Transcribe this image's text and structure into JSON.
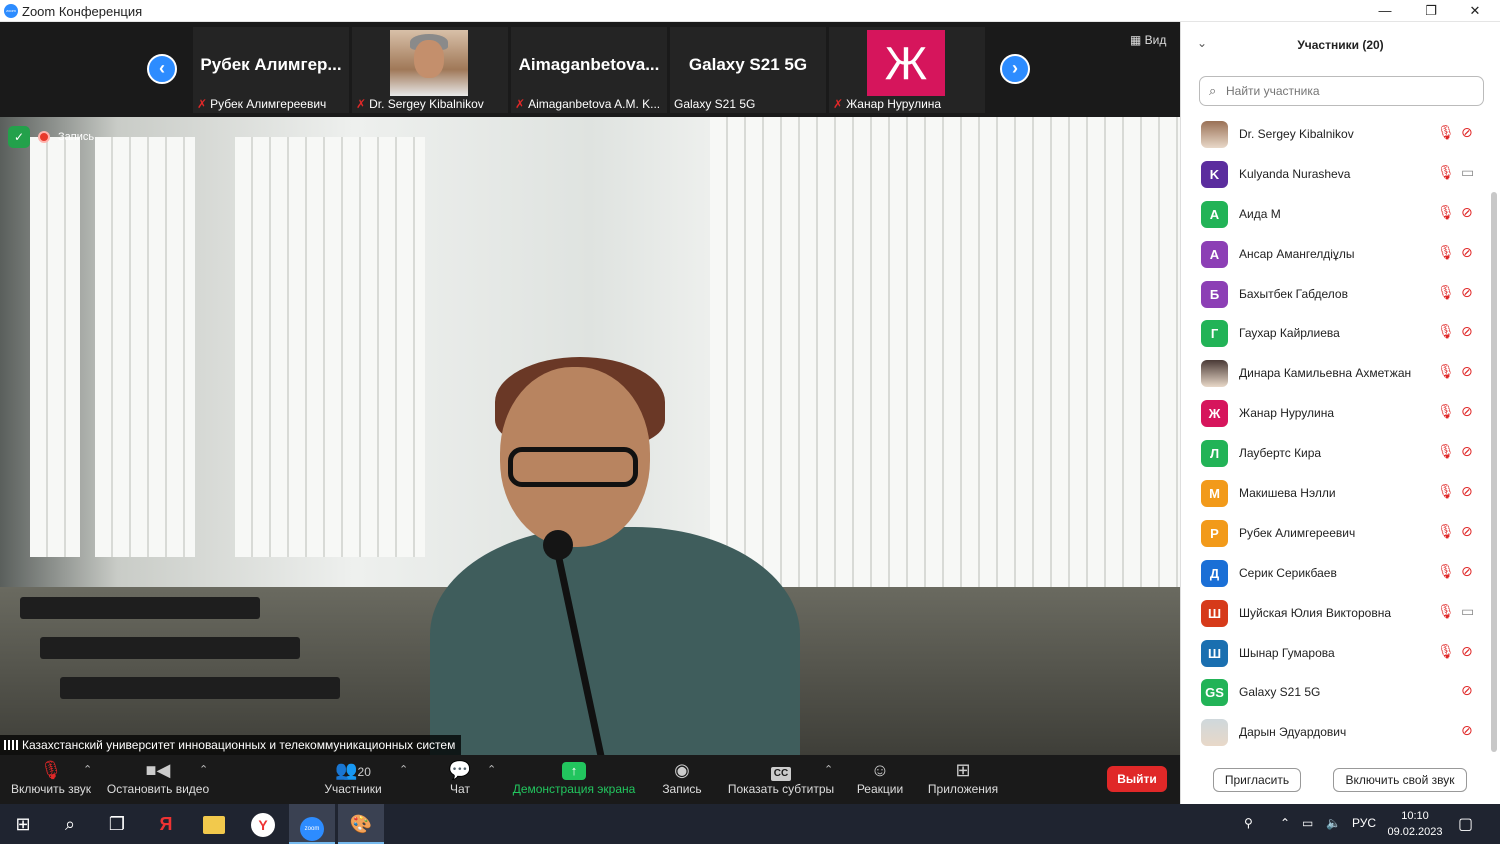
{
  "window": {
    "title": "Zoom Конференция",
    "logo_text": "zoom",
    "minimize": "—",
    "maximize": "❐",
    "close": "✕"
  },
  "strip": {
    "prev": "‹",
    "next": "›",
    "view_label": "Вид",
    "tiles": [
      {
        "name": "Рубек Алимгер...",
        "label": "Рубек Алимгереевич",
        "kind": "text"
      },
      {
        "name": "",
        "label": "Dr. Sergey Kibalnikov",
        "kind": "photo"
      },
      {
        "name": "Aimaganbetova...",
        "label": "Aimaganbetova A.M. K...",
        "kind": "text"
      },
      {
        "name": "Galaxy S21 5G",
        "label": "Galaxy S21 5G",
        "kind": "text"
      },
      {
        "name": "",
        "label": "Жанар Нурулина",
        "kind": "avatar",
        "avatar": "Ж"
      }
    ]
  },
  "video": {
    "recording_label": "Запись",
    "speaker": "Казахстанский университет инновационных и телекоммуникационных систем"
  },
  "toolbar": {
    "unmute": "Включить звук",
    "stop_video": "Остановить видео",
    "participants": "Участники",
    "participants_count": "20",
    "chat": "Чат",
    "share": "Демонстрация экрана",
    "record": "Запись",
    "captions": "Показать субтитры",
    "reactions": "Реакции",
    "apps": "Приложения",
    "leave": "Выйти",
    "captions_icon": "CC"
  },
  "panel": {
    "title": "Участники (20)",
    "search_placeholder": "Найти участника",
    "invite": "Пригласить",
    "unmute_me": "Включить свой звук",
    "participants": [
      {
        "name": "Dr. Sergey Kibalnikov",
        "avatar": "",
        "color": "#9a7156",
        "photo": true,
        "mic": true,
        "cam_on": false
      },
      {
        "name": "Kulyanda Nurasheva",
        "avatar": "K",
        "color": "#5b2d9e",
        "mic": true,
        "cam_on": true
      },
      {
        "name": "Аида М",
        "avatar": "А",
        "color": "#22b357",
        "mic": true,
        "cam_on": false
      },
      {
        "name": "Ансар Амангелдіұлы",
        "avatar": "А",
        "color": "#8c3fb5",
        "mic": true,
        "cam_on": false
      },
      {
        "name": "Бахытбек Габделов",
        "avatar": "Б",
        "color": "#8c3fb5",
        "mic": true,
        "cam_on": false
      },
      {
        "name": "Гаухар Кайрлиева",
        "avatar": "Г",
        "color": "#22b357",
        "mic": true,
        "cam_on": false
      },
      {
        "name": "Динара Камильевна Ахметжан",
        "avatar": "",
        "color": "#4a3a36",
        "photo": true,
        "mic": true,
        "cam_on": false
      },
      {
        "name": "Жанар Нурулина",
        "avatar": "Ж",
        "color": "#d6155c",
        "mic": true,
        "cam_on": false
      },
      {
        "name": "Лаубертс Кира",
        "avatar": "Л",
        "color": "#22b357",
        "mic": true,
        "cam_on": false
      },
      {
        "name": "Макишева Нэлли",
        "avatar": "М",
        "color": "#f29a1a",
        "mic": true,
        "cam_on": false
      },
      {
        "name": "Рубек Алимгереевич",
        "avatar": "Р",
        "color": "#f29a1a",
        "mic": true,
        "cam_on": false
      },
      {
        "name": "Серик Серикбаев",
        "avatar": "Д",
        "color": "#1a6fd6",
        "mic": true,
        "cam_on": false
      },
      {
        "name": "Шуйская Юлия Викторовна",
        "avatar": "Ш",
        "color": "#d63a1a",
        "mic": true,
        "cam_on": true
      },
      {
        "name": "Шынар Гумарова",
        "avatar": "Ш",
        "color": "#1a6fb0",
        "mic": true,
        "cam_on": false
      },
      {
        "name": "Galaxy S21 5G",
        "avatar": "GS",
        "color": "#22b357",
        "mic": false,
        "cam_on": false
      },
      {
        "name": "Дарын Эдуардович",
        "avatar": "",
        "color": "#cfd8dc",
        "photo": true,
        "mic": false,
        "cam_on": false
      }
    ]
  },
  "taskbar": {
    "lang": "РУС",
    "time": "10:10",
    "date": "09.02.2023"
  },
  "colors": {
    "accent": "#2d8cff",
    "danger": "#e02828",
    "share_green": "#22c55e"
  }
}
